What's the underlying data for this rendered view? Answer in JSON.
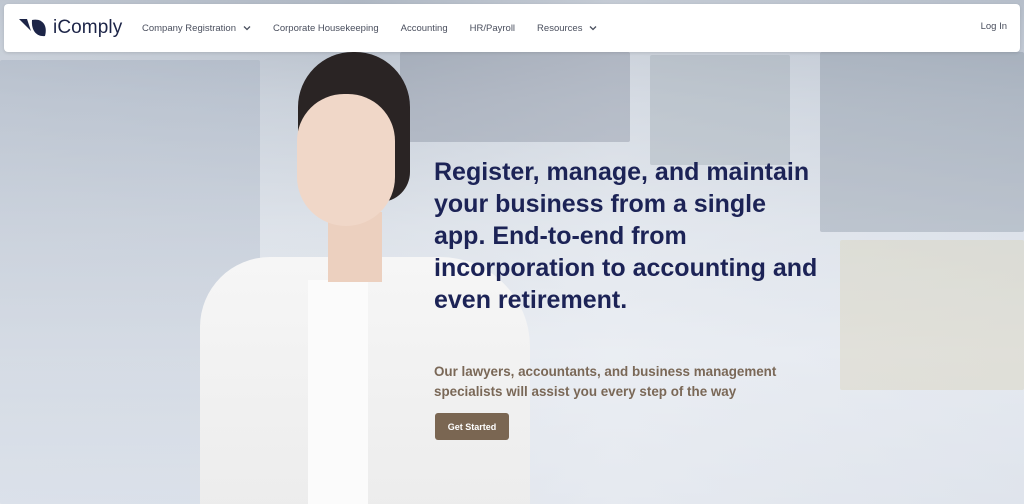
{
  "brand": {
    "name": "iComply",
    "icon": "leaf-logo-icon",
    "color": "#1c2447"
  },
  "nav": {
    "items": [
      {
        "label": "Company Registration",
        "has_dropdown": true
      },
      {
        "label": "Corporate Housekeeping",
        "has_dropdown": false
      },
      {
        "label": "Accounting",
        "has_dropdown": false
      },
      {
        "label": "HR/Payroll",
        "has_dropdown": false
      },
      {
        "label": "Resources",
        "has_dropdown": true
      }
    ],
    "login_label": "Log In"
  },
  "hero": {
    "headline": "Register, manage, and maintain your business from a single app. End-to-end from incorporation to accounting and even retirement.",
    "subtext": "Our lawyers, accountants, and business management specialists will assist you every step of the way",
    "cta_label": "Get Started",
    "background_image": "smiling woman in white blazer in office"
  },
  "colors": {
    "headline": "#1c2356",
    "subtext": "#7a6857",
    "cta_bg": "#7a6652"
  }
}
